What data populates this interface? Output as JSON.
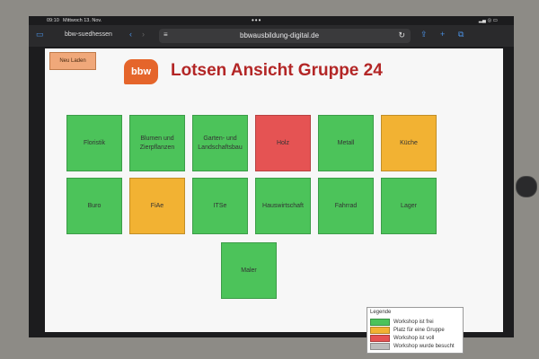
{
  "status": {
    "time": "09:10",
    "date": "Mittwoch 13. Nov.",
    "dots": "•••",
    "batt": "▂▄ ◎ ▭"
  },
  "browser": {
    "tab_label": "bbw-suedhessen",
    "url": "bbwausbildung-digital.de",
    "reader_icon": "reader-icon",
    "reload_icon": "↻"
  },
  "page": {
    "reload_button": "Neu Laden",
    "logo_text": "bbw",
    "title": "Lotsen Ansicht Gruppe 24"
  },
  "tiles": [
    {
      "label": "Floristik",
      "status": "frei"
    },
    {
      "label": "Blumen und Zierpflanzen",
      "status": "frei"
    },
    {
      "label": "Garten- und Landschaftsbau",
      "status": "frei"
    },
    {
      "label": "Holz",
      "status": "voll"
    },
    {
      "label": "Metall",
      "status": "frei"
    },
    {
      "label": "Küche",
      "status": "gruppe"
    },
    {
      "label": "Buro",
      "status": "frei"
    },
    {
      "label": "FiAe",
      "status": "gruppe"
    },
    {
      "label": "ITSe",
      "status": "frei"
    },
    {
      "label": "Hauswirtschaft",
      "status": "frei"
    },
    {
      "label": "Fahrrad",
      "status": "frei"
    },
    {
      "label": "Lager",
      "status": "frei"
    },
    {
      "label": "Maler",
      "status": "frei"
    }
  ],
  "legend": {
    "title": "Legende",
    "items": [
      {
        "label": "Workshop ist frei",
        "color": "#4cc35a"
      },
      {
        "label": "Platz für eine Gruppe",
        "color": "#f2b233"
      },
      {
        "label": "Workshop ist voll",
        "color": "#e55353"
      },
      {
        "label": "Workshop wurde besucht",
        "color": "#bdbdbd"
      }
    ]
  },
  "colors": {
    "frei": "#4cc35a",
    "gruppe": "#f2b233",
    "voll": "#e55353",
    "title": "#b32626",
    "logo": "#e5652b"
  }
}
